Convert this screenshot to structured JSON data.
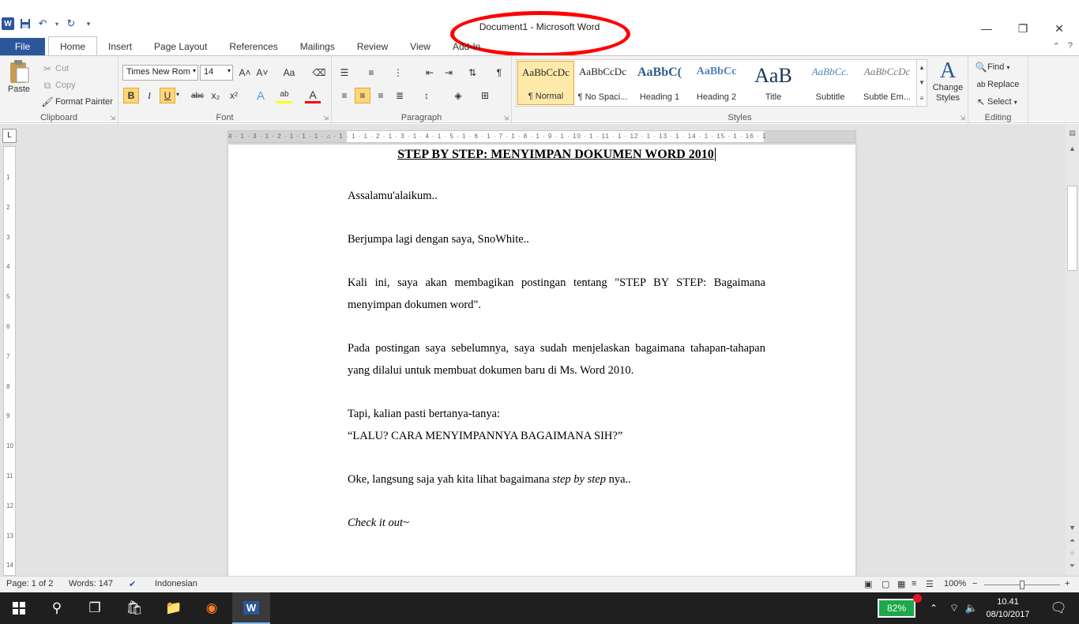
{
  "window": {
    "title": "Document1 - Microsoft Word",
    "controls": {
      "minimize": "—",
      "restore": "❐",
      "close": "✕"
    }
  },
  "quick_access": {
    "icons": [
      "word-logo-icon",
      "save-icon",
      "undo-icon",
      "redo-icon",
      "customize-icon"
    ],
    "logo_text": "W"
  },
  "tabs": [
    {
      "label": "File"
    },
    {
      "label": "Home"
    },
    {
      "label": "Insert"
    },
    {
      "label": "Page Layout"
    },
    {
      "label": "References"
    },
    {
      "label": "Mailings"
    },
    {
      "label": "Review"
    },
    {
      "label": "View"
    },
    {
      "label": "Add-In"
    }
  ],
  "ribbon": {
    "clipboard": {
      "label": "Clipboard",
      "paste": "Paste",
      "cut": "Cut",
      "copy": "Copy",
      "format_painter": "Format Painter"
    },
    "font": {
      "label": "Font",
      "font_name": "Times New Rom",
      "font_size": "14",
      "bold": "B",
      "italic": "I",
      "underline": "U",
      "strike": "abc",
      "subscript": "x₂",
      "superscript": "x²",
      "grow": "A˄",
      "shrink": "A˅",
      "change_case": "Aa",
      "highlight": "ab",
      "font_color": "A"
    },
    "paragraph": {
      "label": "Paragraph",
      "show_marks": "¶"
    },
    "styles": {
      "label": "Styles",
      "items": [
        {
          "preview": "AaBbCcDc",
          "name": "¶ Normal"
        },
        {
          "preview": "AaBbCcDc",
          "name": "¶ No Spaci..."
        },
        {
          "preview": "AaBbC(",
          "name": "Heading 1"
        },
        {
          "preview": "AaBbCc",
          "name": "Heading 2"
        },
        {
          "preview": "AaB",
          "name": "Title"
        },
        {
          "preview": "AaBbCc.",
          "name": "Subtitle"
        },
        {
          "preview": "AaBbCcDc",
          "name": "Subtle Em..."
        }
      ],
      "change_styles": "Change Styles"
    },
    "editing": {
      "label": "Editing",
      "find": "Find",
      "replace": "Replace",
      "select": "Select"
    }
  },
  "ruler": {
    "ticks": "4 · 1 · 3 · 1 · 2 · 1 · 1 · 1 · ⌂ · 1 · 1 · 1 · 2 · 1 · 3 · 1 · 4 · 1 · 5 · 1 · 6 · 1 · 7 · 1 · 8 · 1 · 9 · 1 · 10 · 1 · 11 · 1 · 12 · 1 · 13 · 1 · 14 · 1 · 15 · 1 · 16 · 1",
    "vertical_marks": [
      "1",
      "2",
      "3",
      "4",
      "5",
      "6",
      "7",
      "8",
      "9",
      "10",
      "11",
      "12",
      "13",
      "14"
    ]
  },
  "document": {
    "title": "STEP BY STEP: MENYIMPAN DOKUMEN WORD 2010",
    "p1": "Assalamu'alaikum..",
    "p2": "Berjumpa lagi dengan saya, SnoWhite..",
    "p3": "Kali ini, saya akan membagikan postingan tentang \"STEP BY STEP: Bagaimana menyimpan dokumen word\".",
    "p4": "Pada postingan saya sebelumnya, saya sudah menjelaskan bagaimana tahapan-tahapan yang dilalui untuk membuat dokumen baru di Ms. Word 2010.",
    "p5a": "Tapi, kalian pasti bertanya-tanya:",
    "p5b": "“LALU? CARA MENYIMPANNYA BAGAIMANA SIH?”",
    "p6_before": "Oke, langsung saja yah kita lihat bagaimana ",
    "p6_italic": "step by step",
    "p6_after": " nya..",
    "p7": "Check it out~"
  },
  "status": {
    "page": "Page: 1 of 2",
    "words": "Words: 147",
    "language": "Indonesian",
    "zoom": "100%",
    "zoom_minus": "−",
    "zoom_plus": "+",
    "zoom_level_fraction": 0.5
  },
  "taskbar": {
    "battery": "82%",
    "time": "10.41",
    "date": "08/10/2017"
  },
  "colors": {
    "accent": "#2b579a",
    "annotation": "#ff0000",
    "battery": "#1ca84b"
  }
}
